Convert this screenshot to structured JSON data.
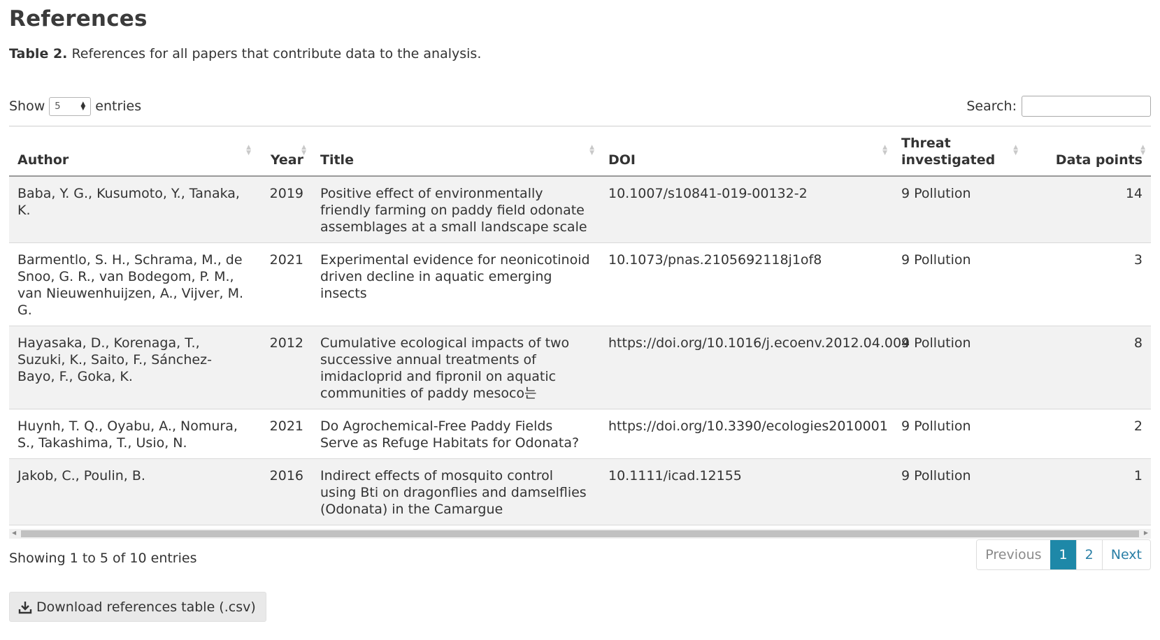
{
  "heading": "References",
  "caption": {
    "label": "Table 2.",
    "text": "References for all papers that contribute data to the analysis."
  },
  "length_control": {
    "prefix": "Show",
    "selected": "5",
    "suffix": "entries"
  },
  "search": {
    "label": "Search:",
    "value": ""
  },
  "table": {
    "columns": [
      "Author",
      "Year",
      "Title",
      "DOI",
      "Threat investigated",
      "Data points"
    ],
    "rows": [
      {
        "author": "Baba, Y. G., Kusumoto, Y., Tanaka, K.",
        "year": "2019",
        "title": "Positive effect of environmentally friendly farming on paddy field odonate assemblages at a small landscape scale",
        "doi": "10.1007/s10841-019-00132-2",
        "threat": "9 Pollution",
        "points": "14"
      },
      {
        "author": "Barmentlo, S. H., Schrama, M., de Snoo, G. R., van Bodegom, P. M., van Nieuwenhuijzen, A., Vijver, M. G.",
        "year": "2021",
        "title": "Experimental evidence for neonicotinoid driven decline in aquatic emerging insects",
        "doi": "10.1073/pnas.2105692118j1of8",
        "threat": "9 Pollution",
        "points": "3"
      },
      {
        "author": "Hayasaka, D., Korenaga, T., Suzuki, K., Saito, F., Sánchez-Bayo, F., Goka, K.",
        "year": "2012",
        "title": "Cumulative ecological impacts of two successive annual treatments of imidacloprid and fipronil on aquatic communities of paddy mesoco는",
        "doi": "https://doi.org/10.1016/j.ecoenv.2012.04.004",
        "threat": "9 Pollution",
        "points": "8"
      },
      {
        "author": "Huynh, T. Q., Oyabu, A., Nomura, S., Takashima, T., Usio, N.",
        "year": "2021",
        "title": "Do Agrochemical-Free Paddy Fields Serve as Refuge Habitats for Odonata?",
        "doi": "https://doi.org/10.3390/ecologies2010001",
        "threat": "9 Pollution",
        "points": "2"
      },
      {
        "author": "Jakob, C., Poulin, B.",
        "year": "2016",
        "title": "Indirect effects of mosquito control using Bti on dragonflies and damselflies (Odonata) in the Camargue",
        "doi": "10.1111/icad.12155",
        "threat": "9 Pollution",
        "points": "1"
      }
    ]
  },
  "info": "Showing 1 to 5 of 10 entries",
  "pagination": {
    "previous": "Previous",
    "pages": [
      "1",
      "2"
    ],
    "next": "Next",
    "active_page": "1"
  },
  "download": {
    "label": "Download references table (.csv)",
    "icon": "download-icon"
  }
}
